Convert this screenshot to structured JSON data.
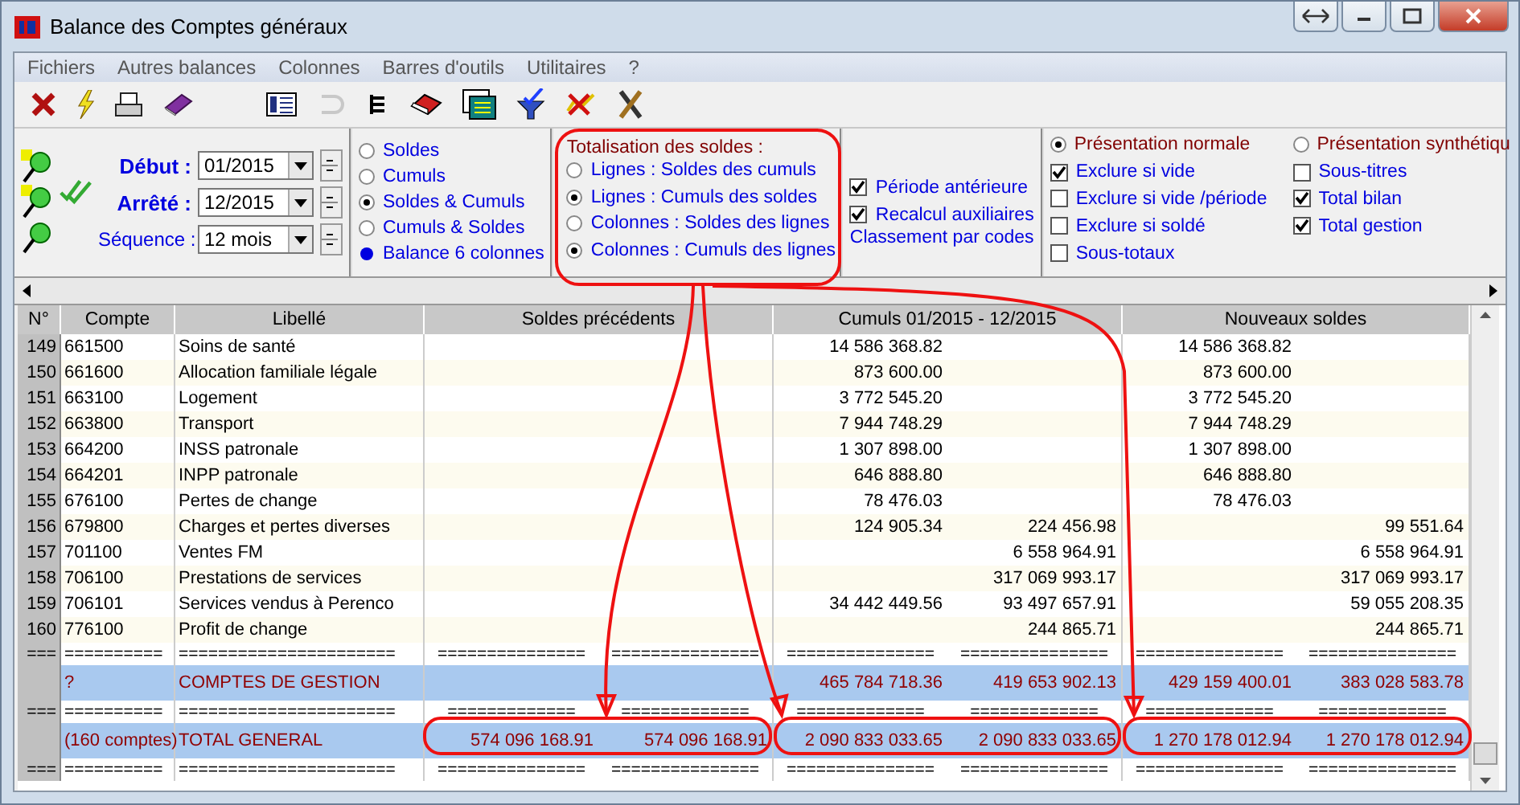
{
  "window": {
    "title": "Balance des Comptes généraux"
  },
  "menu": [
    "Fichiers",
    "Autres balances",
    "Colonnes",
    "Barres d'outils",
    "Utilitaires",
    "?"
  ],
  "period": [
    {
      "label": "Début :",
      "value": "01/2015",
      "bold": true
    },
    {
      "label": "Arrêté :",
      "value": "12/2015",
      "bold": true
    },
    {
      "label": "Séquence :",
      "value": "12 mois",
      "bold": false
    }
  ],
  "display_mode": [
    {
      "label": "Soldes",
      "kind": "radio",
      "selected": false
    },
    {
      "label": "Cumuls",
      "kind": "radio",
      "selected": false
    },
    {
      "label": "Soldes & Cumuls",
      "kind": "radio",
      "selected": true
    },
    {
      "label": "Cumuls & Soldes",
      "kind": "radio",
      "selected": false
    },
    {
      "label": "Balance 6 colonnes",
      "kind": "bullet"
    }
  ],
  "totalisation": {
    "title": "Totalisation des soldes :",
    "options": [
      {
        "label": "Lignes : Soldes des cumuls",
        "selected": false
      },
      {
        "label": "Lignes : Cumuls des soldes",
        "selected": true
      },
      {
        "label": "Colonnes : Soldes des lignes",
        "selected": false
      },
      {
        "label": "Colonnes : Cumuls des lignes",
        "selected": true
      }
    ]
  },
  "options": [
    {
      "label": "Période antérieure",
      "checked": true
    },
    {
      "label": "Recalcul auxiliaires",
      "checked": true
    }
  ],
  "sort_label": "Classement par codes",
  "presentation": [
    [
      {
        "label": "Présentation normale",
        "kind": "radio",
        "selected": true
      },
      {
        "label": "Exclure si vide",
        "kind": "check",
        "checked": true
      },
      {
        "label": "Exclure si vide /période",
        "kind": "check",
        "checked": false
      },
      {
        "label": "Exclure si soldé",
        "kind": "check",
        "checked": false
      },
      {
        "label": "Sous-totaux",
        "kind": "check",
        "checked": false
      }
    ],
    [
      {
        "label": "Présentation synthétiqu",
        "kind": "radio",
        "selected": false
      },
      {
        "label": "Sous-titres",
        "kind": "check",
        "checked": false
      },
      {
        "label": "Total bilan",
        "kind": "check",
        "checked": true
      },
      {
        "label": "Total gestion",
        "kind": "check",
        "checked": true
      }
    ]
  ],
  "table": {
    "columns": [
      "N°",
      "Compte",
      "Libellé",
      "Soldes précédents",
      "Cumuls 01/2015 - 12/2015",
      "Nouveaux soldes"
    ],
    "rows": [
      {
        "kind": "line",
        "n": "149",
        "compte": "661500",
        "libelle": "Soins de santé",
        "amounts": {
          "c3": "14 586 368.82",
          "c5": "14 586 368.82"
        }
      },
      {
        "kind": "line",
        "n": "150",
        "compte": "661600",
        "libelle": "Allocation familiale légale",
        "amounts": {
          "c3": "873 600.00",
          "c5": "873 600.00"
        }
      },
      {
        "kind": "line",
        "n": "151",
        "compte": "663100",
        "libelle": "Logement",
        "amounts": {
          "c3": "3 772 545.20",
          "c5": "3 772 545.20"
        }
      },
      {
        "kind": "line",
        "n": "152",
        "compte": "663800",
        "libelle": "Transport",
        "amounts": {
          "c3": "7 944 748.29",
          "c5": "7 944 748.29"
        }
      },
      {
        "kind": "line",
        "n": "153",
        "compte": "664200",
        "libelle": "INSS patronale",
        "amounts": {
          "c3": "1 307 898.00",
          "c5": "1 307 898.00"
        }
      },
      {
        "kind": "line",
        "n": "154",
        "compte": "664201",
        "libelle": "INPP patronale",
        "amounts": {
          "c3": "646 888.80",
          "c5": "646 888.80"
        }
      },
      {
        "kind": "line",
        "n": "155",
        "compte": "676100",
        "libelle": "Pertes de change",
        "amounts": {
          "c3": "78 476.03",
          "c5": "78 476.03"
        }
      },
      {
        "kind": "line",
        "n": "156",
        "compte": "679800",
        "libelle": "Charges et pertes diverses",
        "amounts": {
          "c3": "124 905.34",
          "c4": "224 456.98",
          "c6": "99 551.64"
        }
      },
      {
        "kind": "line",
        "n": "157",
        "compte": "701100",
        "libelle": "Ventes FM",
        "amounts": {
          "c4": "6 558 964.91",
          "c6": "6 558 964.91"
        }
      },
      {
        "kind": "line",
        "n": "158",
        "compte": "706100",
        "libelle": "Prestations de services",
        "amounts": {
          "c4": "317 069 993.17",
          "c6": "317 069 993.17"
        }
      },
      {
        "kind": "line",
        "n": "159",
        "compte": "706101",
        "libelle": "Services vendus à Perenco",
        "amounts": {
          "c3": "34 442 449.56",
          "c4": "93 497 657.91",
          "c6": "59 055 208.35"
        }
      },
      {
        "kind": "line",
        "n": "160",
        "compte": "776100",
        "libelle": "Profit de change",
        "amounts": {
          "c4": "244 865.71",
          "c6": "244 865.71"
        }
      },
      {
        "kind": "separator",
        "cells": [
          "===",
          "==========",
          "======================",
          "===============",
          "===============",
          "===============",
          "===============",
          "===============",
          "==============="
        ]
      },
      {
        "kind": "total",
        "compte": "?",
        "libelle": "COMPTES DE GESTION",
        "amounts": {
          "c3": "465 784 718.36",
          "c4": "419 653 902.13",
          "c5": "429 159 400.01",
          "c6": "383 028 583.78"
        }
      },
      {
        "kind": "separator",
        "cells": [
          "===",
          "==========",
          "======================",
          "=============",
          "=============",
          "=============",
          "=============",
          "=============",
          "============="
        ]
      },
      {
        "kind": "total",
        "compte": "(160 comptes)",
        "libelle": "TOTAL GENERAL",
        "amounts": {
          "c1": "574 096 168.91",
          "c2": "574 096 168.91",
          "c3": "2 090 833 033.65",
          "c4": "2 090 833 033.65",
          "c5": "1 270 178 012.94",
          "c6": "1 270 178 012.94"
        }
      },
      {
        "kind": "separator",
        "cells": [
          "===",
          "==========",
          "======================",
          "===============",
          "===============",
          "===============",
          "===============",
          "===============",
          "==============="
        ]
      }
    ]
  }
}
